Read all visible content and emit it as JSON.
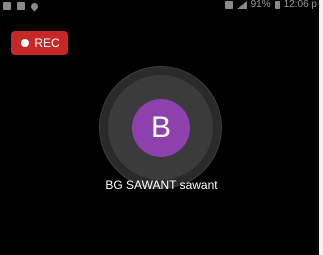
{
  "status_bar": {
    "signal_text": "91%",
    "time": "12:06 p"
  },
  "rec_button": {
    "label": "REC",
    "color": "#c62828"
  },
  "participant": {
    "initial": "B",
    "name": "BG SAWANT sawant",
    "avatar_color": "#8e40ad"
  }
}
